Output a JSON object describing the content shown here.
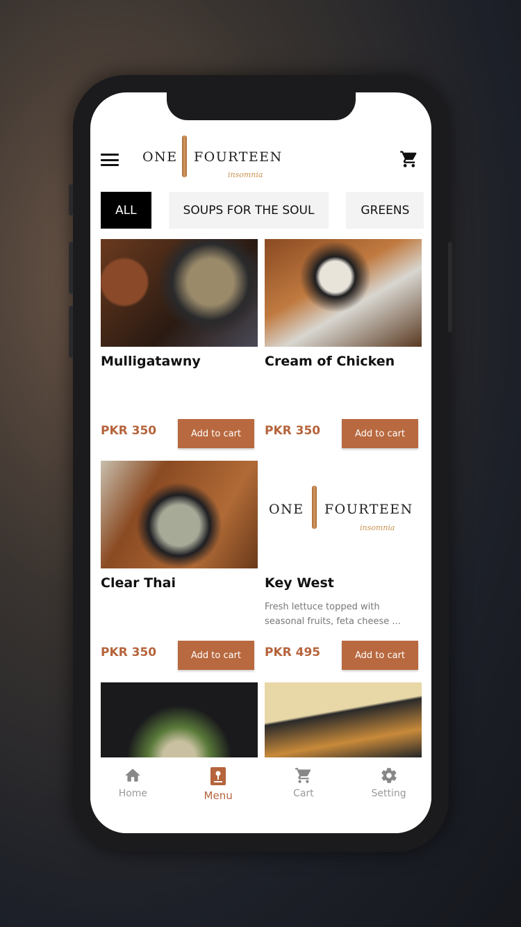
{
  "header": {
    "logo_left": "ONE",
    "logo_right": "FOURTEEN",
    "logo_sub": "insomnia"
  },
  "tabs": [
    {
      "label": "ALL",
      "active": true
    },
    {
      "label": "SOUPS FOR THE SOUL",
      "active": false
    },
    {
      "label": "GREENS",
      "active": false
    }
  ],
  "items": [
    {
      "name": "Mulligatawny",
      "description": "",
      "price": "PKR 350",
      "button": "Add to cart"
    },
    {
      "name": "Cream of Chicken",
      "description": "",
      "price": "PKR 350",
      "button": "Add to cart"
    },
    {
      "name": "Clear Thai",
      "description": "",
      "price": "PKR 350",
      "button": "Add to cart"
    },
    {
      "name": "Key West",
      "description": "Fresh lettuce topped with seasonal fruits, feta cheese ...",
      "price": "PKR 495",
      "button": "Add to cart"
    }
  ],
  "nav": [
    {
      "label": "Home",
      "icon": "home-icon"
    },
    {
      "label": "Menu",
      "icon": "menu-book-icon",
      "active": true
    },
    {
      "label": "Cart",
      "icon": "cart-icon"
    },
    {
      "label": "Setting",
      "icon": "gear-icon"
    }
  ],
  "colors": {
    "accent": "#b8693f",
    "active_tab": "#000000"
  }
}
